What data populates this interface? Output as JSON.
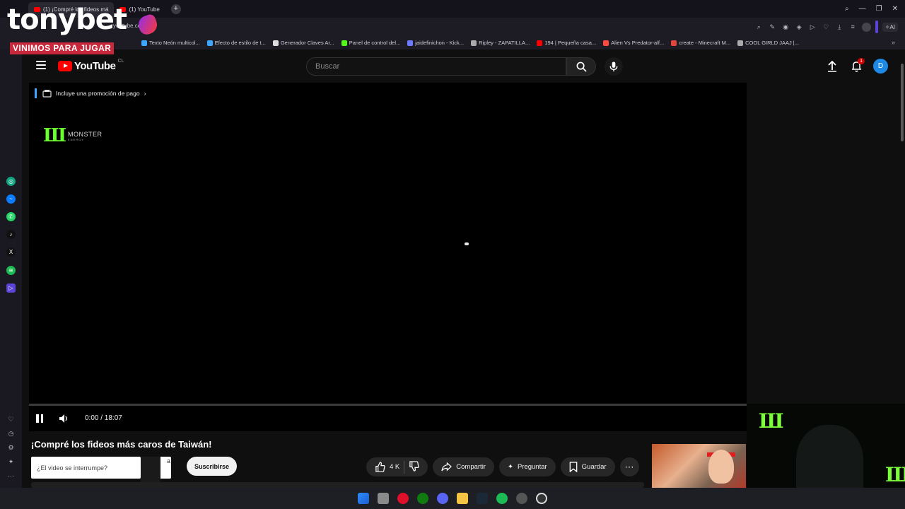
{
  "browser": {
    "tabs": [
      {
        "label": "(1) ¡Compré los fideos má",
        "active": true
      },
      {
        "label": "(1) YouTube",
        "active": false
      }
    ],
    "url": "youtube.com/",
    "ai_label": "AI",
    "bookmarks": [
      {
        "label": "Texto Neón multicol...",
        "color": "#3ea6ff"
      },
      {
        "label": "Efecto de estilo de t...",
        "color": "#3ea6ff"
      },
      {
        "label": "Generador Claves Ar...",
        "color": "#dddddd"
      },
      {
        "label": "Panel de control del...",
        "color": "#53fc18"
      },
      {
        "label": "jaidefinichon - Kick...",
        "color": "#6c7cff"
      },
      {
        "label": "Ripley - ZAPATILLA...",
        "color": "#aaaaaa"
      },
      {
        "label": "194 | Pequeña casa...",
        "color": "#ff0000"
      },
      {
        "label": "Alien Vs Predator-alf...",
        "color": "#ff4a3d"
      },
      {
        "label": "create - Minecraft M...",
        "color": "#e0463a"
      },
      {
        "label": "COOL GIRLD JAAJ |...",
        "color": "#aaaaaa"
      }
    ]
  },
  "overlay": {
    "brand": "tonybet",
    "tagline": "VINIMOS PARA JUGAR"
  },
  "youtube": {
    "logo_text": "YouTube",
    "country_code": "CL",
    "search_placeholder": "Buscar",
    "notification_count": "1",
    "avatar_letter": "D",
    "promo_text": "Incluye una promoción de pago",
    "sponsor_logo_text": "MONSTER",
    "sponsor_logo_sub": "ENERGY",
    "time_display": "0:00 / 18:07",
    "video_title": "¡Compré los fideos más caros de Taiwán!",
    "interrupt_text": "¿El video se interrumpe?",
    "interrupt_fragment": "a",
    "subscribe_label": "Suscribirse",
    "like_count": "4 K",
    "share_label": "Compartir",
    "ask_label": "Preguntar",
    "save_label": "Guardar"
  },
  "colors": {
    "accent_red": "#ff0000",
    "brand_red": "#c8283b",
    "avatar_blue": "#1e88e5",
    "monster_green": "#6aff2f"
  }
}
